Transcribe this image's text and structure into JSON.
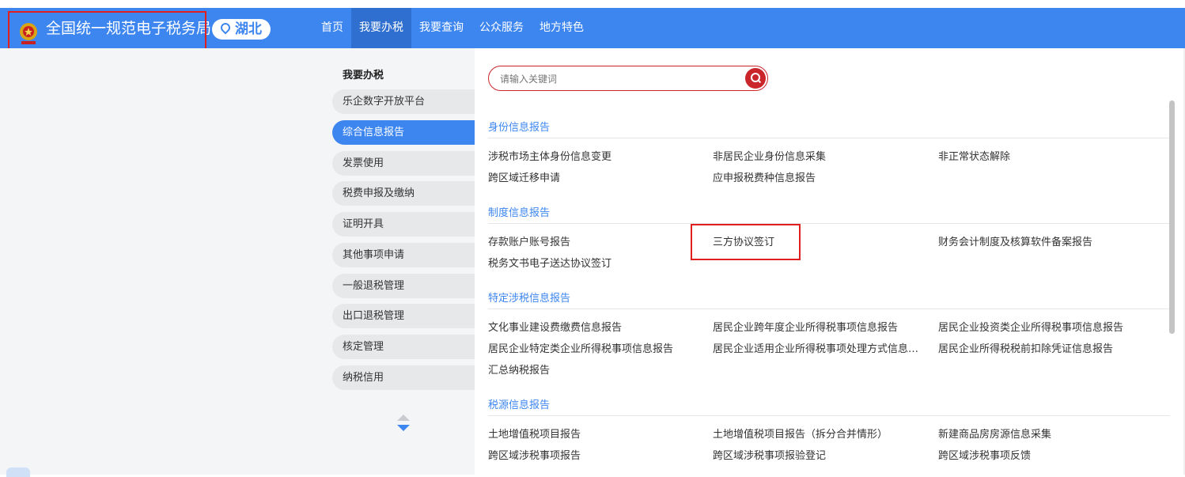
{
  "header": {
    "site_title": "全国统一规范电子税务局",
    "region": "湖北",
    "nav": [
      "首页",
      "我要办税",
      "我要查询",
      "公众服务",
      "地方特色"
    ],
    "nav_active": "我要办税",
    "brand_color": "#3d86f0"
  },
  "sidebar": {
    "title": "我要办税",
    "items": [
      "乐企数字开放平台",
      "综合信息报告",
      "发票使用",
      "税费申报及缴纳",
      "证明开具",
      "其他事项申请",
      "一般退税管理",
      "出口退税管理",
      "核定管理",
      "纳税信用"
    ],
    "active": "综合信息报告"
  },
  "search": {
    "placeholder": "请输入关键词"
  },
  "sections": [
    {
      "title": "身份信息报告",
      "links": [
        "涉税市场主体身份信息变更",
        "非居民企业身份信息采集",
        "非正常状态解除",
        "跨区域迁移申请",
        "应申报税费种信息报告"
      ]
    },
    {
      "title": "制度信息报告",
      "links": [
        "存款账户账号报告",
        "三方协议签订",
        "财务会计制度及核算软件备案报告",
        "税务文书电子送达协议签订"
      ]
    },
    {
      "title": "特定涉税信息报告",
      "links": [
        "文化事业建设费缴费信息报告",
        "居民企业跨年度企业所得税事项信息报告",
        "居民企业投资类企业所得税事项信息报告",
        "居民企业特定类企业所得税事项信息报告",
        "居民企业适用企业所得税事项处理方式信息报...",
        "居民企业所得税税前扣除凭证信息报告",
        "汇总纳税报告"
      ]
    },
    {
      "title": "税源信息报告",
      "links": [
        "土地增值税项目报告",
        "土地增值税项目报告（拆分合并情形）",
        "新建商品房房源信息采集",
        "跨区域涉税事项报告",
        "跨区域涉税事项报验登记",
        "跨区域涉税事项反馈"
      ]
    }
  ]
}
